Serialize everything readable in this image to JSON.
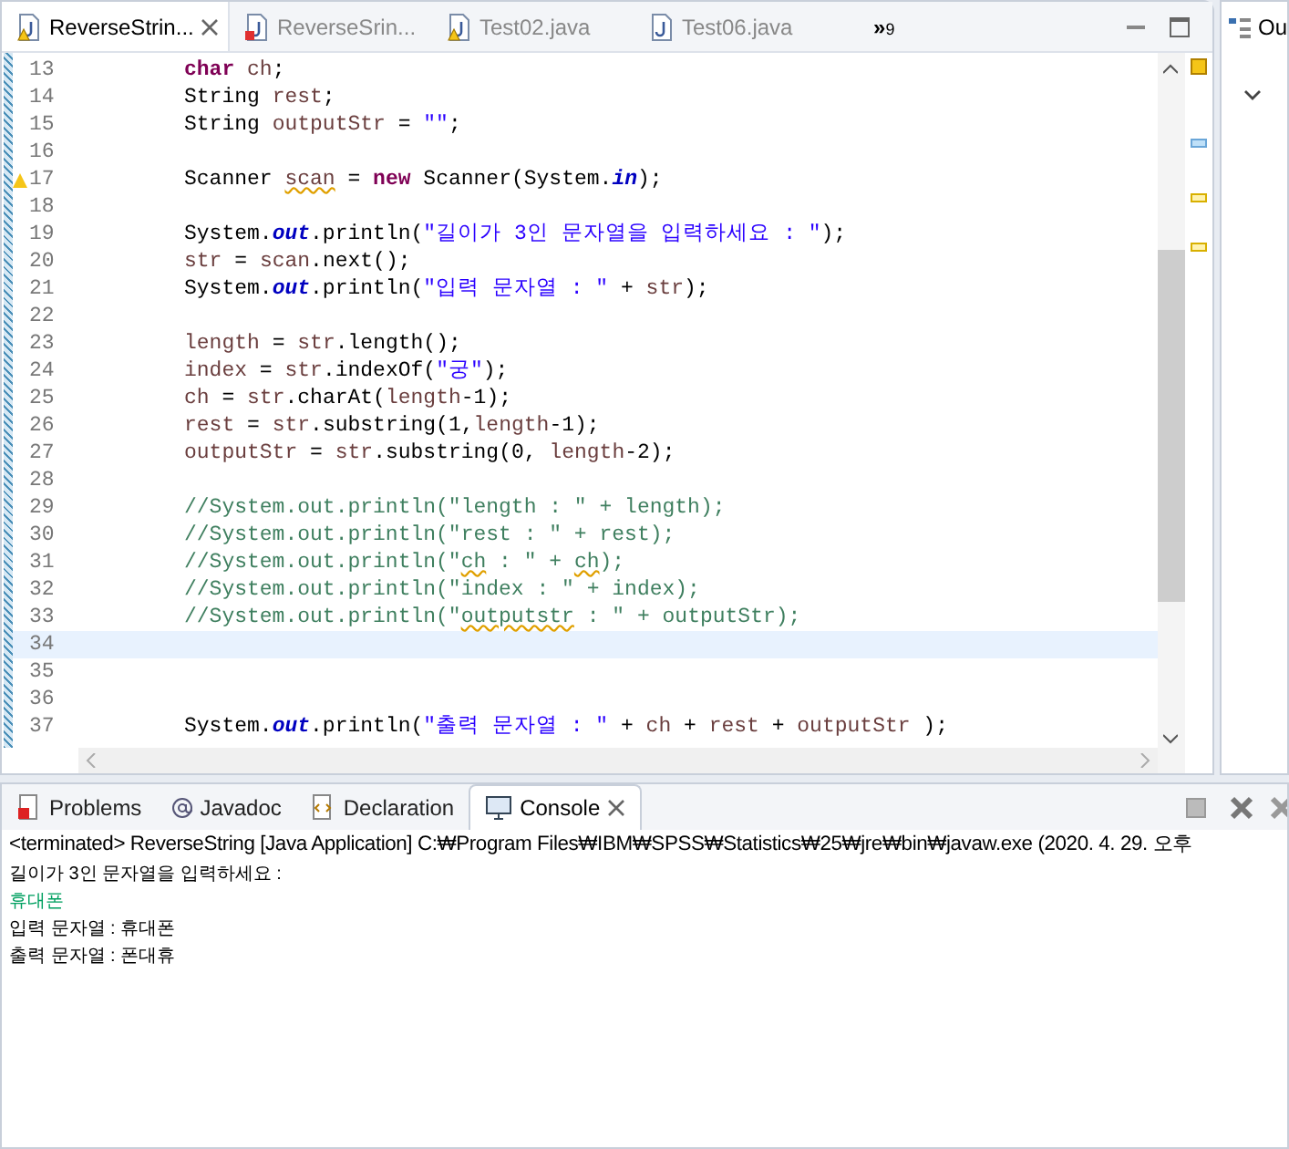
{
  "editor_tabs": [
    {
      "label": "ReverseStrin...",
      "kind": "java-warning",
      "selected": true,
      "closable": true
    },
    {
      "label": "ReverseSrin...",
      "kind": "java-error",
      "selected": false,
      "closable": false
    },
    {
      "label": "Test02.java",
      "kind": "java-warning",
      "selected": false,
      "closable": false
    },
    {
      "label": "Test06.java",
      "kind": "java",
      "selected": false,
      "closable": false
    }
  ],
  "overflow": {
    "symbol": "»",
    "count": "9"
  },
  "code_lines": [
    {
      "number": "13",
      "current": false,
      "warning": false,
      "tokens": [
        {
          "kind": "kw",
          "text": "char"
        },
        {
          "kind": "var",
          "text": " ch"
        },
        {
          "kind": "plain",
          "text": ";"
        }
      ]
    },
    {
      "number": "14",
      "current": false,
      "warning": false,
      "tokens": [
        {
          "kind": "plain",
          "text": "String "
        },
        {
          "kind": "var",
          "text": "rest"
        },
        {
          "kind": "plain",
          "text": ";"
        }
      ]
    },
    {
      "number": "15",
      "current": false,
      "warning": false,
      "tokens": [
        {
          "kind": "plain",
          "text": "String "
        },
        {
          "kind": "var",
          "text": "outputStr"
        },
        {
          "kind": "plain",
          "text": " = "
        },
        {
          "kind": "str",
          "text": "\"\""
        },
        {
          "kind": "plain",
          "text": ";"
        }
      ]
    },
    {
      "number": "16",
      "current": false,
      "warning": false
    },
    {
      "number": "17",
      "current": false,
      "warning": true,
      "tokens": [
        {
          "kind": "plain",
          "text": "Scanner "
        },
        {
          "kind": "var",
          "text": "scan",
          "squiggle": true
        },
        {
          "kind": "plain",
          "text": " = "
        },
        {
          "kind": "kw",
          "text": "new"
        },
        {
          "kind": "plain",
          "text": " Scanner(System."
        },
        {
          "kind": "field",
          "text": "in"
        },
        {
          "kind": "plain",
          "text": ");"
        }
      ]
    },
    {
      "number": "18",
      "current": false,
      "warning": false
    },
    {
      "number": "19",
      "current": false,
      "warning": false,
      "tokens": [
        {
          "kind": "plain",
          "text": "System."
        },
        {
          "kind": "field",
          "text": "out"
        },
        {
          "kind": "plain",
          "text": ".println("
        },
        {
          "kind": "str",
          "text": "\"길이가 3인 문자열을 입력하세요 : \""
        },
        {
          "kind": "plain",
          "text": ");"
        }
      ]
    },
    {
      "number": "20",
      "current": false,
      "warning": false,
      "tokens": [
        {
          "kind": "var",
          "text": "str"
        },
        {
          "kind": "plain",
          "text": " = "
        },
        {
          "kind": "var",
          "text": "scan"
        },
        {
          "kind": "plain",
          "text": ".next();"
        }
      ]
    },
    {
      "number": "21",
      "current": false,
      "warning": false,
      "tokens": [
        {
          "kind": "plain",
          "text": "System."
        },
        {
          "kind": "field",
          "text": "out"
        },
        {
          "kind": "plain",
          "text": ".println("
        },
        {
          "kind": "str",
          "text": "\"입력 문자열 : \""
        },
        {
          "kind": "plain",
          "text": " + "
        },
        {
          "kind": "var",
          "text": "str"
        },
        {
          "kind": "plain",
          "text": ");"
        }
      ]
    },
    {
      "number": "22",
      "current": false,
      "warning": false
    },
    {
      "number": "23",
      "current": false,
      "warning": false,
      "tokens": [
        {
          "kind": "var",
          "text": "length"
        },
        {
          "kind": "plain",
          "text": " = "
        },
        {
          "kind": "var",
          "text": "str"
        },
        {
          "kind": "plain",
          "text": ".length();"
        }
      ]
    },
    {
      "number": "24",
      "current": false,
      "warning": false,
      "tokens": [
        {
          "kind": "var",
          "text": "index"
        },
        {
          "kind": "plain",
          "text": " = "
        },
        {
          "kind": "var",
          "text": "str"
        },
        {
          "kind": "plain",
          "text": ".indexOf("
        },
        {
          "kind": "str",
          "text": "\"궁\""
        },
        {
          "kind": "plain",
          "text": ");"
        }
      ]
    },
    {
      "number": "25",
      "current": false,
      "warning": false,
      "tokens": [
        {
          "kind": "var",
          "text": "ch"
        },
        {
          "kind": "plain",
          "text": " = "
        },
        {
          "kind": "var",
          "text": "str"
        },
        {
          "kind": "plain",
          "text": ".charAt("
        },
        {
          "kind": "var",
          "text": "length"
        },
        {
          "kind": "plain",
          "text": "-1);"
        }
      ]
    },
    {
      "number": "26",
      "current": false,
      "warning": false,
      "tokens": [
        {
          "kind": "var",
          "text": "rest"
        },
        {
          "kind": "plain",
          "text": " = "
        },
        {
          "kind": "var",
          "text": "str"
        },
        {
          "kind": "plain",
          "text": ".substring(1,"
        },
        {
          "kind": "var",
          "text": "length"
        },
        {
          "kind": "plain",
          "text": "-1);"
        }
      ]
    },
    {
      "number": "27",
      "current": false,
      "warning": false,
      "tokens": [
        {
          "kind": "var",
          "text": "outputStr"
        },
        {
          "kind": "plain",
          "text": " = "
        },
        {
          "kind": "var",
          "text": "str"
        },
        {
          "kind": "plain",
          "text": ".substring(0, "
        },
        {
          "kind": "var",
          "text": "length"
        },
        {
          "kind": "plain",
          "text": "-2);"
        }
      ]
    },
    {
      "number": "28",
      "current": false,
      "warning": false
    },
    {
      "number": "29",
      "current": false,
      "warning": false,
      "tokens": [
        {
          "kind": "comment",
          "text": "//System.out.println(\"length : \" + length);"
        }
      ]
    },
    {
      "number": "30",
      "current": false,
      "warning": false,
      "tokens": [
        {
          "kind": "comment",
          "text": "//System.out.println(\"rest : \" + rest);"
        }
      ]
    },
    {
      "number": "31",
      "current": false,
      "warning": false,
      "tokens": [
        {
          "kind": "comment",
          "text": "//System.out.println(\""
        },
        {
          "kind": "comment",
          "text": "ch",
          "squiggle": true
        },
        {
          "kind": "comment",
          "text": " : \" + "
        },
        {
          "kind": "comment",
          "text": "ch",
          "squiggle": true
        },
        {
          "kind": "comment",
          "text": ");"
        }
      ]
    },
    {
      "number": "32",
      "current": false,
      "warning": false,
      "tokens": [
        {
          "kind": "comment",
          "text": "//System.out.println(\"index : \" + index);"
        }
      ]
    },
    {
      "number": "33",
      "current": false,
      "warning": false,
      "tokens": [
        {
          "kind": "comment",
          "text": "//System.out.println(\""
        },
        {
          "kind": "comment",
          "text": "outputstr",
          "squiggle": true
        },
        {
          "kind": "comment",
          "text": " : \" + outputStr);"
        }
      ]
    },
    {
      "number": "34",
      "current": true,
      "warning": false
    },
    {
      "number": "35",
      "current": false,
      "warning": false
    },
    {
      "number": "36",
      "current": false,
      "warning": false
    },
    {
      "number": "37",
      "current": false,
      "warning": false,
      "tokens": [
        {
          "kind": "plain",
          "text": "System."
        },
        {
          "kind": "field",
          "text": "out"
        },
        {
          "kind": "plain",
          "text": ".println("
        },
        {
          "kind": "str",
          "text": "\"출력 문자열 : \""
        },
        {
          "kind": "plain",
          "text": " + "
        },
        {
          "kind": "var",
          "text": "ch"
        },
        {
          "kind": "plain",
          "text": " + "
        },
        {
          "kind": "var",
          "text": "rest"
        },
        {
          "kind": "plain",
          "text": " + "
        },
        {
          "kind": "var",
          "text": "outputStr"
        },
        {
          "kind": "plain",
          "text": " );"
        }
      ]
    }
  ],
  "outline_panel": {
    "title": "Ou"
  },
  "bottom_tabs": [
    {
      "label": "Problems",
      "kind": "problems",
      "selected": false,
      "closable": false
    },
    {
      "label": "Javadoc",
      "kind": "javadoc",
      "selected": false,
      "closable": false
    },
    {
      "label": "Declaration",
      "kind": "declaration",
      "selected": false,
      "closable": false
    },
    {
      "label": "Console",
      "kind": "console",
      "selected": true,
      "closable": true
    }
  ],
  "console": {
    "header": "<terminated> ReverseString [Java Application] C:₩Program Files₩IBM₩SPSS₩Statistics₩25₩jre₩bin₩javaw.exe (2020. 4. 29. 오후",
    "lines": [
      {
        "kind": "output",
        "text": "길이가 3인 문자열을 입력하세요 : "
      },
      {
        "kind": "input",
        "text": "휴대폰"
      },
      {
        "kind": "output",
        "text": "입력 문자열 : 휴대폰"
      },
      {
        "kind": "output",
        "text": "출력 문자열 : 폰대휴"
      }
    ]
  }
}
